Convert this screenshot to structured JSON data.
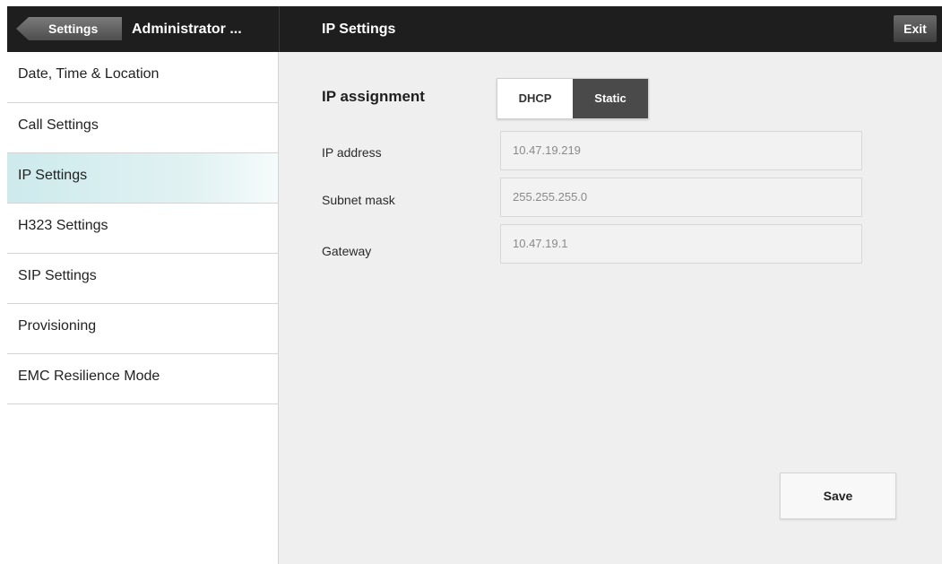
{
  "header": {
    "back_label": "Settings",
    "section_title": "Administrator ...",
    "page_title": "IP Settings",
    "exit_label": "Exit"
  },
  "sidebar": {
    "items": [
      {
        "label": "Date, Time & Location",
        "active": false
      },
      {
        "label": "Call Settings",
        "active": false
      },
      {
        "label": "IP Settings",
        "active": true
      },
      {
        "label": "H323 Settings",
        "active": false
      },
      {
        "label": "SIP Settings",
        "active": false
      },
      {
        "label": "Provisioning",
        "active": false
      },
      {
        "label": "EMC Resilience Mode",
        "active": false
      }
    ]
  },
  "main": {
    "ip_assignment_label": "IP assignment",
    "assignment_options": [
      "DHCP",
      "Static"
    ],
    "selected_assignment": "Static",
    "fields": [
      {
        "label": "IP address",
        "value": "10.47.19.219"
      },
      {
        "label": "Subnet mask",
        "value": "255.255.255.0"
      },
      {
        "label": "Gateway",
        "value": "10.47.19.1"
      }
    ],
    "save_label": "Save"
  },
  "colors": {
    "topbar": "#1e1e1e",
    "active_item": "#cdeaec",
    "selected_toggle": "#4a4a4a"
  }
}
